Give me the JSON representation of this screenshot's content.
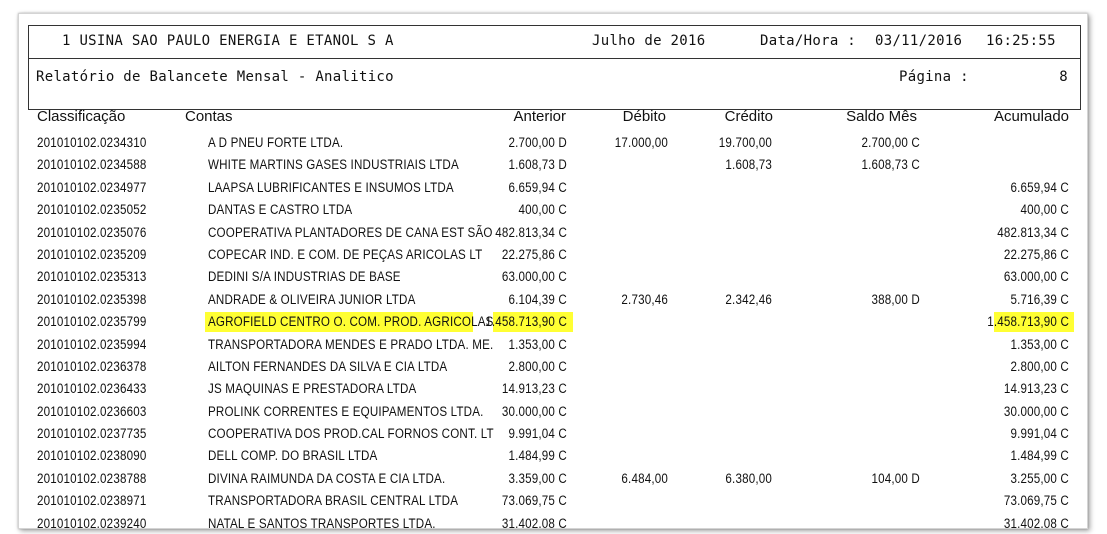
{
  "header": {
    "company": "1 USINA SAO PAULO ENERGIA E ETANOL S A",
    "period": "Julho de 2016",
    "datetime_label": "Data/Hora :",
    "date": "03/11/2016",
    "time": "16:25:55",
    "report_title": "Relatório de Balancete Mensal - Analitico",
    "page_label": "Página :",
    "page_number": "8"
  },
  "columns": {
    "classificacao": "Classificação",
    "contas": "Contas",
    "anterior": "Anterior",
    "debito": "Débito",
    "credito": "Crédito",
    "saldo_mes": "Saldo Mês",
    "acumulado": "Acumulado"
  },
  "highlight_color": "#ffff33",
  "rows": [
    {
      "code": "201010102.0234310",
      "name": "A D PNEU FORTE LTDA.",
      "anterior": "2.700,00 D",
      "debito": "17.000,00",
      "credito": "19.700,00",
      "saldo": "2.700,00 C",
      "acumulado": "",
      "highlighted": false
    },
    {
      "code": "201010102.0234588",
      "name": "WHITE MARTINS GASES INDUSTRIAIS LTDA",
      "anterior": "1.608,73 D",
      "debito": "",
      "credito": "1.608,73",
      "saldo": "1.608,73 C",
      "acumulado": "",
      "highlighted": false
    },
    {
      "code": "201010102.0234977",
      "name": "LAAPSA LUBRIFICANTES E INSUMOS LTDA",
      "anterior": "6.659,94 C",
      "debito": "",
      "credito": "",
      "saldo": "",
      "acumulado": "6.659,94 C",
      "highlighted": false
    },
    {
      "code": "201010102.0235052",
      "name": "DANTAS E CASTRO LTDA",
      "anterior": "400,00 C",
      "debito": "",
      "credito": "",
      "saldo": "",
      "acumulado": "400,00 C",
      "highlighted": false
    },
    {
      "code": "201010102.0235076",
      "name": "COOPERATIVA PLANTADORES DE CANA EST SÃO",
      "anterior": "482.813,34 C",
      "debito": "",
      "credito": "",
      "saldo": "",
      "acumulado": "482.813,34 C",
      "highlighted": false
    },
    {
      "code": "201010102.0235209",
      "name": "COPECAR IND. E COM. DE PEÇAS ARICOLAS LT",
      "anterior": "22.275,86 C",
      "debito": "",
      "credito": "",
      "saldo": "",
      "acumulado": "22.275,86 C",
      "highlighted": false
    },
    {
      "code": "201010102.0235313",
      "name": "DEDINI S/A INDUSTRIAS DE  BASE",
      "anterior": "63.000,00 C",
      "debito": "",
      "credito": "",
      "saldo": "",
      "acumulado": "63.000,00 C",
      "highlighted": false
    },
    {
      "code": "201010102.0235398",
      "name": "ANDRADE & OLIVEIRA JUNIOR LTDA",
      "anterior": "6.104,39 C",
      "debito": "2.730,46",
      "credito": "2.342,46",
      "saldo": "388,00 D",
      "acumulado": "5.716,39 C",
      "highlighted": false
    },
    {
      "code": "201010102.0235799",
      "name": "AGROFIELD CENTRO O. COM. PROD. AGRICOLAS",
      "anterior": "1.458.713,90 C",
      "debito": "",
      "credito": "",
      "saldo": "",
      "acumulado": "1.458.713,90 C",
      "highlighted": true
    },
    {
      "code": "201010102.0235994",
      "name": "TRANSPORTADORA MENDES E PRADO LTDA. ME.",
      "anterior": "1.353,00 C",
      "debito": "",
      "credito": "",
      "saldo": "",
      "acumulado": "1.353,00 C",
      "highlighted": false
    },
    {
      "code": "201010102.0236378",
      "name": "AILTON FERNANDES DA SILVA E CIA LTDA",
      "anterior": "2.800,00 C",
      "debito": "",
      "credito": "",
      "saldo": "",
      "acumulado": "2.800,00 C",
      "highlighted": false
    },
    {
      "code": "201010102.0236433",
      "name": "JS MAQUINAS E PRESTADORA  LTDA",
      "anterior": "14.913,23 C",
      "debito": "",
      "credito": "",
      "saldo": "",
      "acumulado": "14.913,23 C",
      "highlighted": false
    },
    {
      "code": "201010102.0236603",
      "name": "PROLINK CORRENTES E EQUIPAMENTOS LTDA.",
      "anterior": "30.000,00 C",
      "debito": "",
      "credito": "",
      "saldo": "",
      "acumulado": "30.000,00 C",
      "highlighted": false
    },
    {
      "code": "201010102.0237735",
      "name": "COOPERATIVA DOS PROD.CAL FORNOS CONT. LT",
      "anterior": "9.991,04 C",
      "debito": "",
      "credito": "",
      "saldo": "",
      "acumulado": "9.991,04 C",
      "highlighted": false
    },
    {
      "code": "201010102.0238090",
      "name": "DELL COMP. DO BRASIL LTDA",
      "anterior": "1.484,99 C",
      "debito": "",
      "credito": "",
      "saldo": "",
      "acumulado": "1.484,99 C",
      "highlighted": false
    },
    {
      "code": "201010102.0238788",
      "name": "DIVINA RAIMUNDA DA COSTA E CIA LTDA.",
      "anterior": "3.359,00 C",
      "debito": "6.484,00",
      "credito": "6.380,00",
      "saldo": "104,00 D",
      "acumulado": "3.255,00 C",
      "highlighted": false
    },
    {
      "code": "201010102.0238971",
      "name": "TRANSPORTADORA BRASIL CENTRAL LTDA",
      "anterior": "73.069,75 C",
      "debito": "",
      "credito": "",
      "saldo": "",
      "acumulado": "73.069,75 C",
      "highlighted": false
    },
    {
      "code": "201010102.0239240",
      "name": "NATAL E SANTOS TRANSPORTES LTDA.",
      "anterior": "31.402,08 C",
      "debito": "",
      "credito": "",
      "saldo": "",
      "acumulado": "31.402,08 C",
      "highlighted": false
    }
  ]
}
